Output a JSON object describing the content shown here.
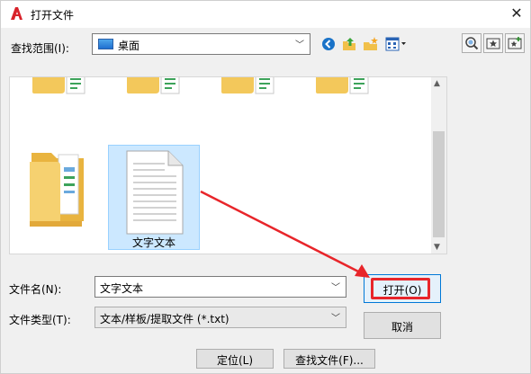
{
  "window": {
    "title": "打开文件",
    "close_glyph": "✕",
    "app_icon": "autocad-a-icon"
  },
  "lookin": {
    "label": "查找范围(I):",
    "value": "桌面",
    "icon": "desktop-icon"
  },
  "toolbar": {
    "icons": [
      "back-icon",
      "up-folder-icon",
      "new-folder-icon",
      "view-menu-icon"
    ],
    "right_icons": [
      "search-web-icon",
      "favorites-icon",
      "add-favorite-icon"
    ]
  },
  "filelist": {
    "items": [
      {
        "type": "folder",
        "label": ""
      },
      {
        "type": "text-file",
        "label": "文字文本",
        "selected": true
      }
    ]
  },
  "form": {
    "filename_label": "文件名(N):",
    "filename_value": "文字文本",
    "filetype_label": "文件类型(T):",
    "filetype_value": "文本/样板/提取文件 (*.txt)"
  },
  "buttons": {
    "open": "打开(O)",
    "cancel": "取消",
    "locate": "定位(L)",
    "find": "查找文件(F)..."
  },
  "colors": {
    "highlight": "#e8252a",
    "selection": "#cce8ff"
  }
}
